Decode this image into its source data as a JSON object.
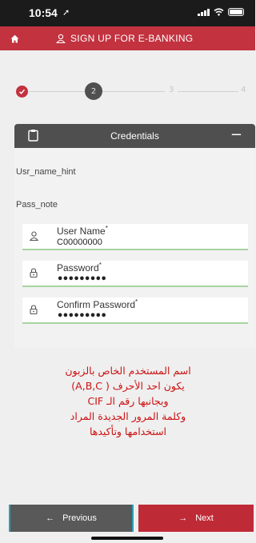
{
  "status_bar": {
    "time": "10:54",
    "location_glyph": "➚"
  },
  "app_bar": {
    "home_icon": "home-icon",
    "user_icon": "user-icon",
    "title": "SIGN UP FOR E-BANKING"
  },
  "stepper": {
    "steps": [
      "1",
      "2",
      "3",
      "4"
    ],
    "current_step": "2",
    "completed_steps": 1
  },
  "credentials_card": {
    "title": "Credentials",
    "collapse_label": "−",
    "username_hint": "Usr_name_hint",
    "password_note": "Pass_note",
    "fields": {
      "username": {
        "label": "User Name",
        "required_mark": "*",
        "value": "C00000000"
      },
      "password": {
        "label": "Password",
        "required_mark": "*",
        "value": "•••••••••"
      },
      "confirm_password": {
        "label": "Confirm Password",
        "required_mark": "*",
        "value": "•••••••••"
      }
    }
  },
  "annotation": {
    "lines": [
      "اسم المستخدم الخاص بالزبون",
      "يكون احد الأحرف ( A,B,C)",
      "وبجانبها رقم الـ CIF",
      "وكلمة المرور الجديدة المراد",
      "استخدامها وتأكيدها"
    ],
    "color": "#cc1111"
  },
  "footer": {
    "previous_label": "Previous",
    "next_label": "Next",
    "previous_icon": "←",
    "next_icon": "→"
  },
  "colors": {
    "brand": "#c2323f",
    "header_dark": "#4f4f4f",
    "valid_underline": "#a8d4a0"
  }
}
